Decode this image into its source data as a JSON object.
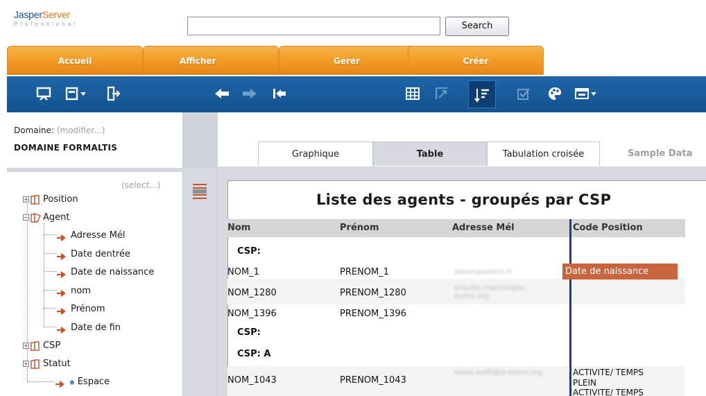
{
  "header": {
    "logo_main_1": "Jasper",
    "logo_main_2": "Server",
    "logo_sub": "Professional",
    "search_placeholder": "",
    "search_button": "Search"
  },
  "tabs": [
    {
      "label": "Accueil"
    },
    {
      "label": "Afficher"
    },
    {
      "label": "Gérer"
    },
    {
      "label": "Créer"
    }
  ],
  "toolbar": {
    "icons": [
      "presentation-icon",
      "save-icon",
      "export-icon",
      "back-arrow-icon",
      "forward-arrow-icon",
      "undo-all-icon",
      "grid-icon",
      "pivot-icon",
      "sort-icon",
      "checkbox-icon",
      "palette-icon",
      "layout-icon"
    ]
  },
  "left_panel": {
    "domain_label": "Domaine:",
    "domain_modifier": "(modifier...)",
    "domain_name": "DOMAINE FORMALTIS",
    "select_link": "(select...)",
    "tree": [
      {
        "label": "Position"
      },
      {
        "label": "Agent"
      },
      {
        "label": "Adresse Mél"
      },
      {
        "label": "Date dentrée"
      },
      {
        "label": "Date de naissance"
      },
      {
        "label": "nom"
      },
      {
        "label": "Prénom"
      },
      {
        "label": "Date de fin"
      },
      {
        "label": "CSP"
      },
      {
        "label": "Statut"
      },
      {
        "label": "Espace"
      }
    ]
  },
  "view_tabs": [
    {
      "label": "Graphique"
    },
    {
      "label": "Table"
    },
    {
      "label": "Tabulation croisée"
    },
    {
      "label": "Sample Data"
    }
  ],
  "report": {
    "title": "Liste des agents - groupés par CSP",
    "columns": [
      "Nom",
      "Prénom",
      "Adresse Mél",
      "Code Position"
    ],
    "drop_label": "Date de naissance",
    "rows": [
      {
        "group": "CSP:"
      },
      {
        "nom": "NOM_1",
        "prenom": "PRENOM_1",
        "email": "admin@admin.fr",
        "code": ""
      },
      {
        "nom": "NOM_1280",
        "prenom": "PRENOM_1280",
        "email": "priscilla.masella@la-metro.org",
        "code": ""
      },
      {
        "nom": "NOM_1396",
        "prenom": "PRENOM_1396",
        "email": "",
        "code": ""
      },
      {
        "group": "CSP:"
      },
      {
        "group": "CSP: A"
      },
      {
        "nom": "NOM_1043",
        "prenom": "PRENOM_1043",
        "email": "nadia.wolff@la-metro.org",
        "code_line1": "ACTIVITE/ TEMPS",
        "code_line2": "PLEIN",
        "code_next": "ACTIVITE/ TEMPS"
      }
    ]
  }
}
